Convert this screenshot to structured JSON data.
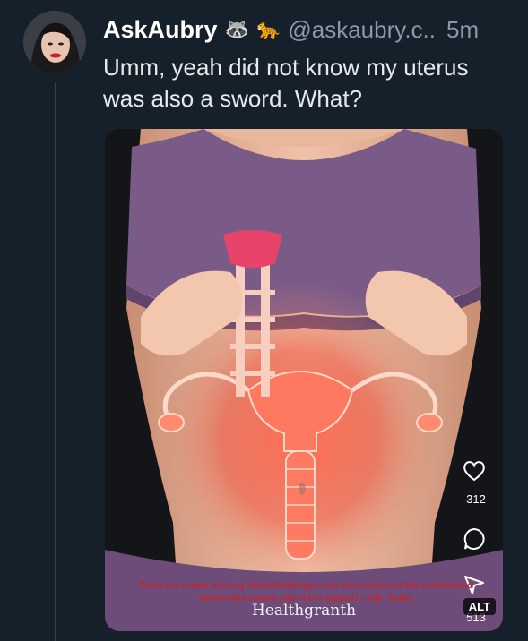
{
  "tweet": {
    "display_name": "AskAubry",
    "handle": "@askaubry.c..",
    "time": "5m",
    "badges": [
      "raccoon-emoji",
      "leopard-emoji"
    ],
    "text": "Umm, yeah did not know my uterus was also a sword. What?"
  },
  "media": {
    "description_icons": [
      "heart-icon",
      "comment-icon",
      "share-icon"
    ],
    "like_count": "312",
    "share_count": "513",
    "watermark": "Posts are meant to bring forward dialogue and discussions of the problematic sentiments shown and not in support - Ask_Aubry",
    "brand": "Healthgranth",
    "alt_label": "ALT"
  },
  "colors": {
    "background": "#15202b",
    "muted": "#8b98a5",
    "uterus_glow": "#ff5a4a",
    "top": "#7a5a86"
  }
}
